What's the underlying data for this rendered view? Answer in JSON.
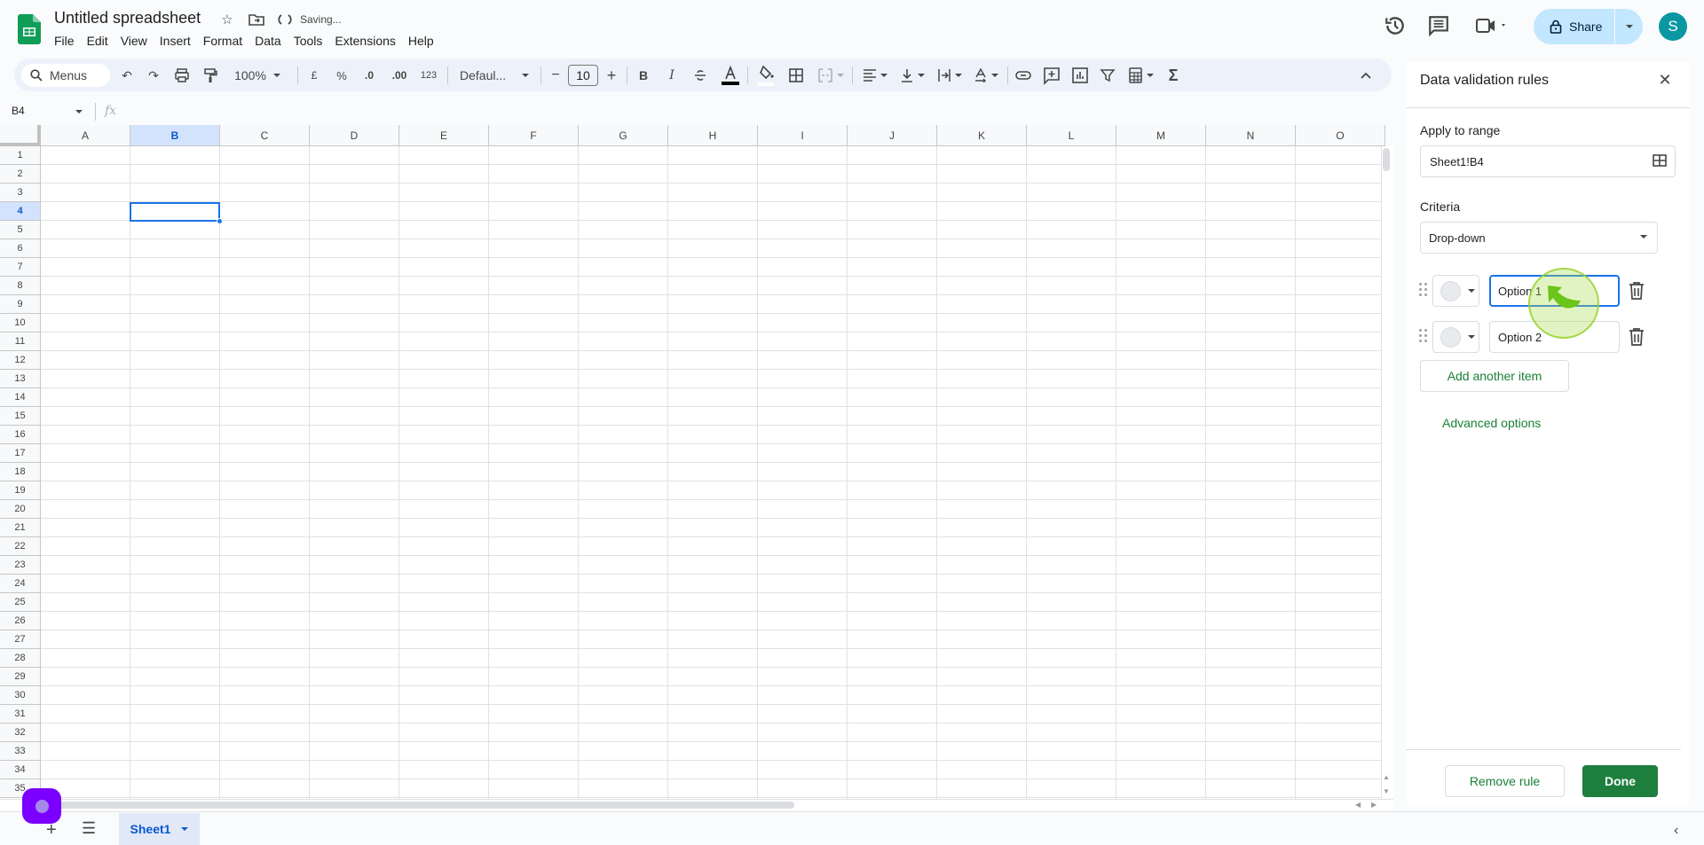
{
  "header": {
    "title": "Untitled spreadsheet",
    "save_status": "Saving...",
    "menu": [
      "File",
      "Edit",
      "View",
      "Insert",
      "Format",
      "Data",
      "Tools",
      "Extensions",
      "Help"
    ],
    "share_label": "Share",
    "avatar_initial": "S"
  },
  "toolbar": {
    "menus_search": "Menus",
    "zoom": "100%",
    "currency": "£",
    "percent": "%",
    "decrease_decimal": ".0",
    "increase_decimal": ".00",
    "number_format": "123",
    "font": "Defaul...",
    "font_size": "10",
    "minus": "−",
    "plus": "+",
    "bold": "B",
    "italic": "I",
    "sum": "Σ"
  },
  "formula_bar": {
    "name_box": "B4",
    "fx": "fx",
    "value": ""
  },
  "grid": {
    "columns": [
      "A",
      "B",
      "C",
      "D",
      "E",
      "F",
      "G",
      "H",
      "I",
      "J",
      "K",
      "L",
      "M",
      "N",
      "O"
    ],
    "rows": [
      "1",
      "2",
      "3",
      "4",
      "5",
      "6",
      "7",
      "8",
      "9",
      "10",
      "11",
      "12",
      "13",
      "14",
      "15",
      "16",
      "17",
      "18",
      "19",
      "20",
      "21",
      "22",
      "23",
      "24",
      "25",
      "26",
      "27",
      "28",
      "29",
      "30",
      "31",
      "32",
      "33",
      "34",
      "35"
    ],
    "selected_cell": "B4",
    "selected_column": "B",
    "selected_row": "4"
  },
  "sheets": {
    "tabs": [
      {
        "label": "Sheet1",
        "active": true
      }
    ]
  },
  "panel": {
    "title": "Data validation rules",
    "apply_to_range_label": "Apply to range",
    "range_value": "Sheet1!B4",
    "criteria_label": "Criteria",
    "criteria_value": "Drop-down",
    "options": [
      {
        "value": "Option 1",
        "focused": true,
        "color": "#e8eaed"
      },
      {
        "value": "Option 2",
        "focused": false,
        "color": "#e8eaed"
      }
    ],
    "add_item_label": "Add another item",
    "advanced_label": "Advanced options",
    "remove_rule_label": "Remove rule",
    "done_label": "Done"
  },
  "colors": {
    "accent_green": "#188038",
    "done_green": "#1e7e3e",
    "selection_blue": "#1a73e8",
    "share_bg": "#c2e7ff",
    "avatar_bg": "#0a97a1"
  }
}
